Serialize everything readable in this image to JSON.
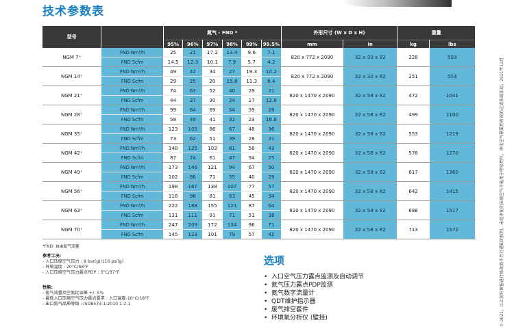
{
  "page": {
    "title": "技术参数表",
    "footnote": "*FND: 自由氮气流量",
    "side_note": "© 2021，以上资料保留进行修改而不另行通知的权利，未经净化的压缩空气不能用于呼吸用气，净化空气需要用有效的过滤系统实现，2021年12月"
  },
  "table": {
    "header": {
      "model": "型号",
      "nitrogen_group": "氮气 - FND *",
      "dimensions_group": "外形尺寸 (W x D x H)",
      "weight_group": "重量",
      "purity": [
        "95%",
        "96%",
        "97%",
        "98%",
        "99%",
        "99.5%"
      ],
      "dim_units": [
        "mm",
        "in"
      ],
      "weight_units": [
        "kg",
        "lbs"
      ]
    },
    "unit_labels": [
      "FND Nm³/h",
      "FND Scfm"
    ],
    "rows": [
      {
        "model": "NGM 7⁺",
        "nm3h": [
          "25",
          "21",
          "17.2",
          "13.4",
          "9.6",
          "7.1"
        ],
        "scfm": [
          "14.5",
          "12.3",
          "10.1",
          "7.9",
          "5.7",
          "4.2"
        ],
        "mm": "820 x 772 x 2090",
        "in": "32 x 30 x 82",
        "kg": "228",
        "lbs": "503"
      },
      {
        "model": "NGM 14⁺",
        "nm3h": [
          "49",
          "42",
          "34",
          "27",
          "19.3",
          "14.2"
        ],
        "scfm": [
          "29",
          "25",
          "20",
          "15.8",
          "11.3",
          "8.4"
        ],
        "mm": "820 x 772 x 2090",
        "in": "32 x 30 x 82",
        "kg": "251",
        "lbs": "553"
      },
      {
        "model": "NGM 21⁺",
        "nm3h": [
          "74",
          "63",
          "52",
          "40",
          "29",
          "21"
        ],
        "scfm": [
          "44",
          "37",
          "30",
          "24",
          "17",
          "12.6"
        ],
        "mm": "820 x 1470 x 2090",
        "in": "32 x 58 x 82",
        "kg": "472",
        "lbs": "1041"
      },
      {
        "model": "NGM 28⁺",
        "nm3h": [
          "99",
          "84",
          "69",
          "54",
          "39",
          "28"
        ],
        "scfm": [
          "58",
          "49",
          "41",
          "32",
          "23",
          "16.8"
        ],
        "mm": "820 x 1470 x 2090",
        "in": "32 x 58 x 82",
        "kg": "499",
        "lbs": "1100"
      },
      {
        "model": "NGM 35⁺",
        "nm3h": [
          "123",
          "105",
          "86",
          "67",
          "48",
          "36"
        ],
        "scfm": [
          "73",
          "62",
          "51",
          "39",
          "28",
          "21"
        ],
        "mm": "820 x 1470 x 2090",
        "in": "32 x 58 x 82",
        "kg": "553",
        "lbs": "1219"
      },
      {
        "model": "NGM 42⁺",
        "nm3h": [
          "148",
          "125",
          "103",
          "81",
          "58",
          "43"
        ],
        "scfm": [
          "87",
          "74",
          "61",
          "47",
          "34",
          "25"
        ],
        "mm": "820 x 1470 x 2090",
        "in": "32 x 58 x 82",
        "kg": "576",
        "lbs": "1270"
      },
      {
        "model": "NGM 49⁺",
        "nm3h": [
          "173",
          "146",
          "121",
          "94",
          "67",
          "50"
        ],
        "scfm": [
          "102",
          "86",
          "71",
          "55",
          "40",
          "29"
        ],
        "mm": "820 x 1470 x 2090",
        "in": "32 x 58 x 82",
        "kg": "617",
        "lbs": "1360"
      },
      {
        "model": "NGM 56⁺",
        "nm3h": [
          "198",
          "167",
          "138",
          "107",
          "77",
          "57"
        ],
        "scfm": [
          "116",
          "98",
          "81",
          "63",
          "45",
          "34"
        ],
        "mm": "820 x 1470 x 2090",
        "in": "32 x 58 x 82",
        "kg": "642",
        "lbs": "1415"
      },
      {
        "model": "NGM 63⁺",
        "nm3h": [
          "222",
          "188",
          "155",
          "121",
          "87",
          "64"
        ],
        "scfm": [
          "131",
          "111",
          "91",
          "71",
          "51",
          "38"
        ],
        "mm": "820 x 1470 x 2090",
        "in": "32 x 58 x 82",
        "kg": "688",
        "lbs": "1517"
      },
      {
        "model": "NGM 70⁺",
        "nm3h": [
          "247",
          "209",
          "172",
          "134",
          "96",
          "71"
        ],
        "scfm": [
          "145",
          "123",
          "101",
          "79",
          "57",
          "42"
        ],
        "mm": "820 x 1470 x 2090",
        "in": "32 x 58 x 82",
        "kg": "713",
        "lbs": "1572"
      }
    ]
  },
  "reference": {
    "title": "参考工况:",
    "items": [
      "- 入口压缩空气压力 : 8 bar(g)/116 psi(g)",
      "- 环境温度 : 20°C/68°F",
      "- 入口压缩空气压力露点PDP : 3°C/37°F"
    ]
  },
  "performance": {
    "title": "性能:",
    "items": [
      "- 氮气流量及空氮比误差 +/- 5%",
      "- 最低入口压缩空气压力露点要求 : 入口温度-10°C/18°F",
      "- 出口氮气品质等级 : ISO8573-1:2010 1-2-1"
    ]
  },
  "options": {
    "title": "选项",
    "items": [
      "入口空气压力露点监测及自动调节",
      "氮气压力露点PDP监测",
      "氮气数字流量计",
      "QDT维护指示器",
      "废气排空套件",
      "环境氧分析仪 (壁挂)"
    ]
  },
  "colors": {
    "title_blue": "#1a7fc1",
    "header_dark": "#393939",
    "cell_blue": "#62b8d8"
  }
}
